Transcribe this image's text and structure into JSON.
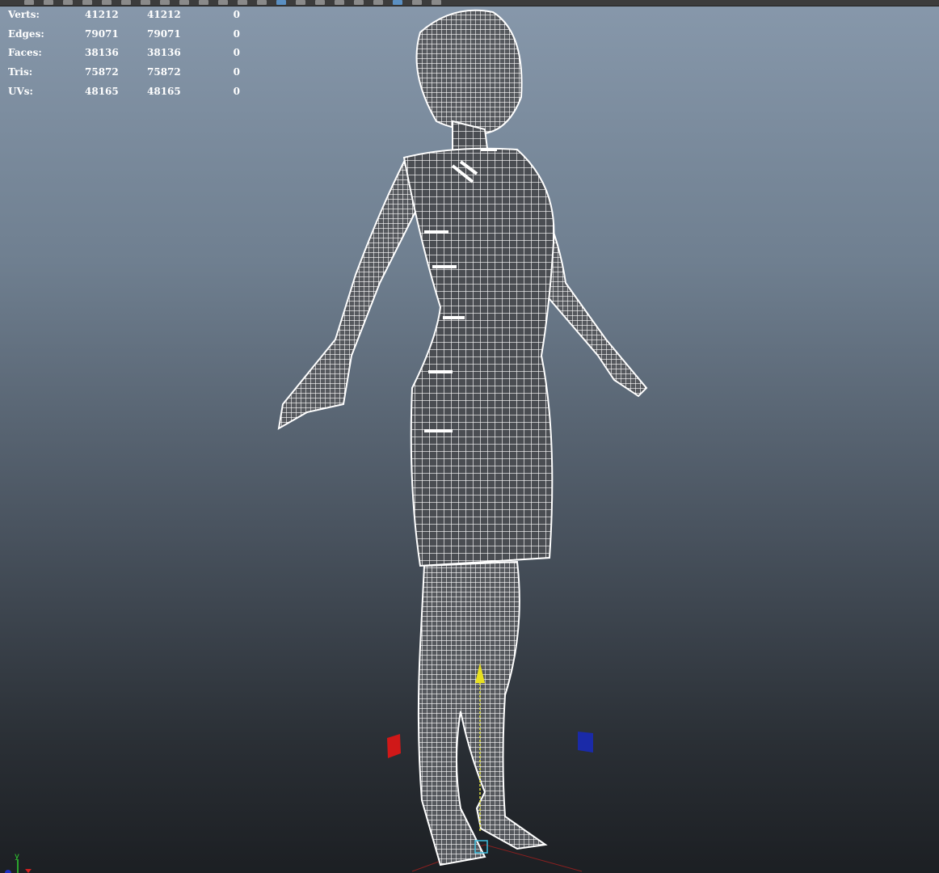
{
  "toolbar": {
    "buttons": 22,
    "active_buttons": [
      13,
      19
    ]
  },
  "hud": {
    "rows": [
      {
        "label": "Verts:",
        "a": "41212",
        "b": "41212",
        "c": "0"
      },
      {
        "label": "Edges:",
        "a": "79071",
        "b": "79071",
        "c": "0"
      },
      {
        "label": "Faces:",
        "a": "38136",
        "b": "38136",
        "c": "0"
      },
      {
        "label": "Tris:",
        "a": "75872",
        "b": "75872",
        "c": "0"
      },
      {
        "label": "UVs:",
        "a": "48165",
        "b": "48165",
        "c": "0"
      }
    ]
  },
  "axis": {
    "y_label": "y",
    "x_color": "#d02020",
    "y_color": "#30d030",
    "z_color": "#2030c0"
  },
  "colors": {
    "wireframe": "#ffffff",
    "mesh_fill": "#4a4d52"
  }
}
